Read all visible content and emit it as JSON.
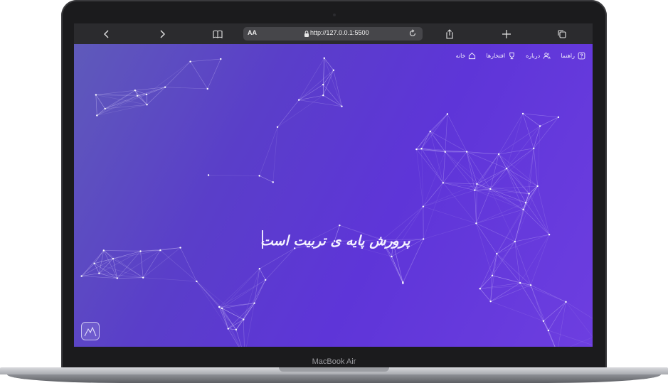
{
  "device": {
    "label": "MacBook Air"
  },
  "browser": {
    "url": "http://127.0.0.1:5500",
    "text_size_label": "AA",
    "icons": [
      "back-icon",
      "forward-icon",
      "bookmarks-icon",
      "lock-icon",
      "reload-icon",
      "share-icon",
      "new-tab-icon",
      "tabs-icon"
    ]
  },
  "page": {
    "nav": [
      {
        "label": "خانه",
        "icon": "home-icon"
      },
      {
        "label": "افتخارها",
        "icon": "trophy-icon"
      },
      {
        "label": "درباره",
        "icon": "users-icon"
      },
      {
        "label": "راهنما",
        "icon": "help-icon"
      }
    ],
    "hero_text": "پرورش پایه ی تربیت است",
    "colors": {
      "bg_start": "#5f5aba",
      "bg_mid": "#5a3ec9",
      "bg_end": "#6d3ee0",
      "text": "#f4f1ff"
    }
  }
}
